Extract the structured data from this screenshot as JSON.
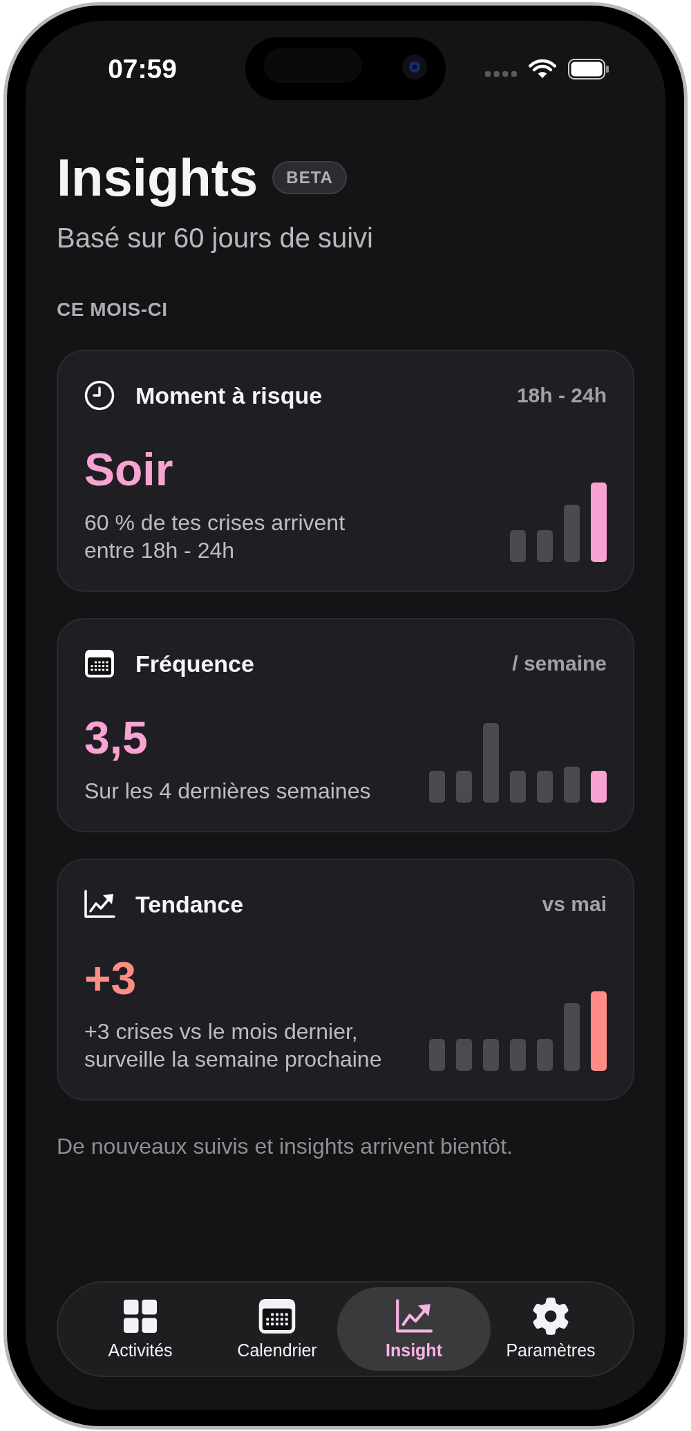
{
  "status_bar": {
    "time": "07:59"
  },
  "header": {
    "title": "Insights",
    "badge": "BETA",
    "subtitle": "Basé sur 60 jours de suivi"
  },
  "section_label": "CE MOIS-CI",
  "cards": [
    {
      "title": "Moment à risque",
      "meta": "18h - 24h",
      "value": "Soir",
      "description": "60 % de tes crises arrivent entre 18h - 24h",
      "color": "#f9a3d3"
    },
    {
      "title": "Fréquence",
      "meta": "/ semaine",
      "value": "3,5",
      "description": "Sur les 4 dernières semaines",
      "color": "#f9a3d3"
    },
    {
      "title": "Tendance",
      "meta": "vs mai",
      "value": "+3",
      "description": "+3 crises vs le mois dernier, surveille la semaine prochaine",
      "color": "#ff8d86"
    }
  ],
  "footer_note": "De nouveaux suivis et insights arrivent bientôt.",
  "tab_bar": {
    "tabs": [
      {
        "label": "Activités",
        "selected": false
      },
      {
        "label": "Calendrier",
        "selected": false
      },
      {
        "label": "Insight",
        "selected": true
      },
      {
        "label": "Paramètres",
        "selected": false
      }
    ]
  }
}
